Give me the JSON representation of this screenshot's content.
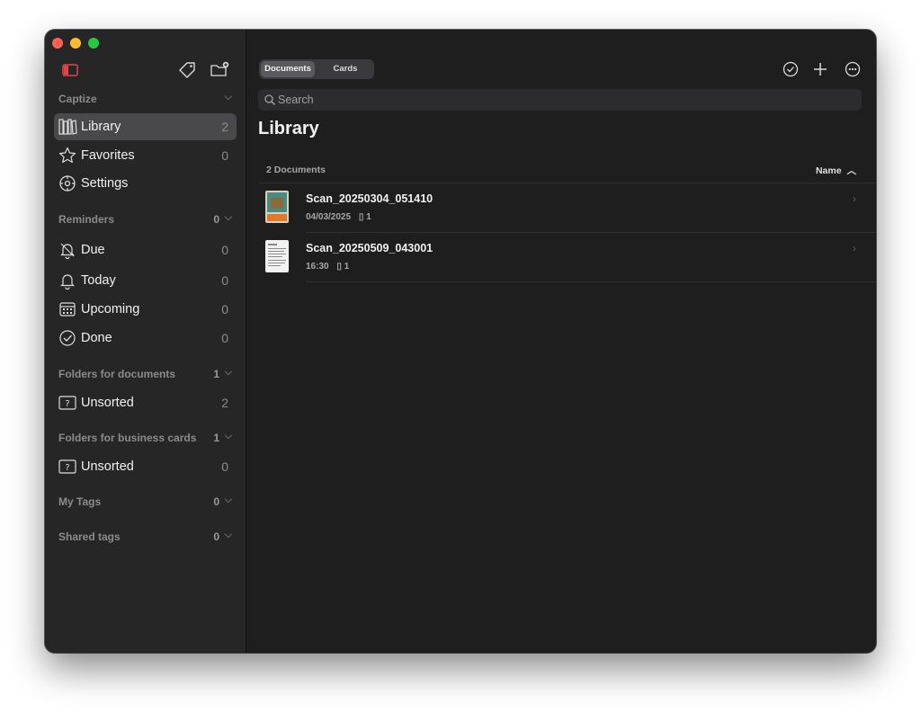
{
  "sidebar": {
    "app_section": "Captize",
    "library": {
      "label": "Library",
      "count": "2"
    },
    "favorites": {
      "label": "Favorites",
      "count": "0"
    },
    "settings": {
      "label": "Settings"
    },
    "reminders": {
      "heading": "Reminders",
      "count": "0",
      "items": [
        {
          "label": "Due",
          "count": "0",
          "icon": "bell-slash-icon"
        },
        {
          "label": "Today",
          "count": "0",
          "icon": "bell-icon"
        },
        {
          "label": "Upcoming",
          "count": "0",
          "icon": "calendar-icon"
        },
        {
          "label": "Done",
          "count": "0",
          "icon": "checkmark-circle-icon"
        }
      ]
    },
    "folders_documents": {
      "heading": "Folders for documents",
      "count": "1",
      "item": {
        "label": "Unsorted",
        "count": "2"
      }
    },
    "folders_cards": {
      "heading": "Folders for business cards",
      "count": "1",
      "item": {
        "label": "Unsorted",
        "count": "0"
      }
    },
    "my_tags": {
      "heading": "My Tags",
      "count": "0"
    },
    "shared_tags": {
      "heading": "Shared tags",
      "count": "0"
    }
  },
  "toolbar": {
    "segments": [
      "Documents",
      "Cards"
    ],
    "selected_segment": "Documents"
  },
  "search": {
    "placeholder": "Search"
  },
  "main": {
    "title": "Library",
    "doc_count": "2 Documents",
    "sort_label": "Name",
    "documents": [
      {
        "name": "Scan_20250304_051410",
        "date": "04/03/2025",
        "pages": "1"
      },
      {
        "name": "Scan_20250509_043001",
        "date": "16:30",
        "pages": "1"
      }
    ]
  },
  "colors": {
    "window_bg": "#1e1e1f",
    "sidebar_bg": "#262627",
    "selected_item": "#49494b",
    "accent_red": "#e0454c"
  }
}
